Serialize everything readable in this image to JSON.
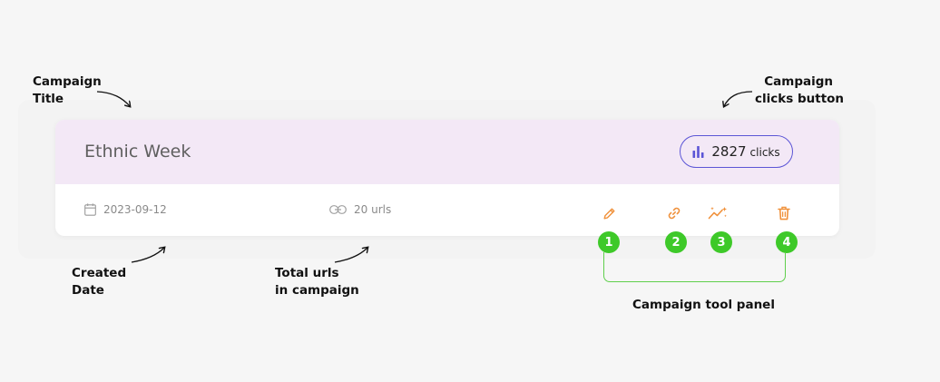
{
  "campaign": {
    "title": "Ethnic Week",
    "clicks_count": "2827",
    "clicks_label": "clicks",
    "created_date": "2023-09-12",
    "total_urls": "20 urls",
    "accent_color": "#5b55d6",
    "header_color": "#f3e8f6",
    "tool_color": "#f0913b"
  },
  "tools": [
    {
      "number": "1",
      "icon": "pencil-icon"
    },
    {
      "number": "2",
      "icon": "link-icon"
    },
    {
      "number": "3",
      "icon": "magic-wand-icon"
    },
    {
      "number": "4",
      "icon": "trash-icon"
    }
  ],
  "annotations": {
    "campaign_title_line1": "Campaign",
    "campaign_title_line2": "Title",
    "clicks_button_line1": "Campaign",
    "clicks_button_line2": "clicks button",
    "created_date_line1": "Created",
    "created_date_line2": "Date",
    "total_urls_line1": "Total urls",
    "total_urls_line2": "in campaign",
    "tool_panel": "Campaign tool panel",
    "badge_color": "#3ec929"
  }
}
